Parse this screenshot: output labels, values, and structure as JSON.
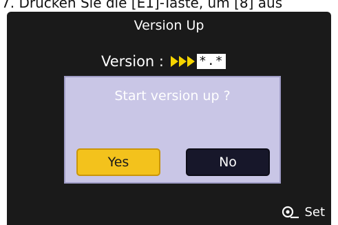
{
  "caption": {
    "text": "7. Drücken Sie die [E1]-Taste, um [8] aus"
  },
  "screen": {
    "title": "Version Up",
    "version_label": "Version :",
    "version_value": "*.*",
    "dialog": {
      "message": "Start version up ?",
      "yes_label": "Yes",
      "no_label": "No",
      "selected": "Yes"
    },
    "footer": {
      "icon": "control-dial-icon",
      "label": "Set"
    }
  },
  "colors": {
    "screen_background": "#1a1a1a",
    "dialog_background": "#c9c6e6",
    "selected_button": "#f3c21c",
    "unselected_button": "#17172a",
    "arrow_accent": "#f5d400"
  }
}
